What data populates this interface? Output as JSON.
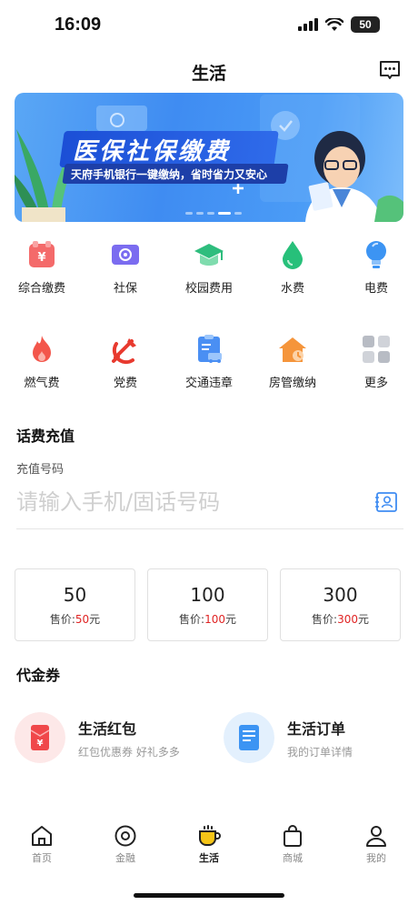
{
  "status": {
    "time": "16:09",
    "battery": "50"
  },
  "header": {
    "title": "生活",
    "message_icon": "chat-bubble-icon"
  },
  "banner": {
    "title": "医保社保缴费",
    "subtitle": "天府手机银行一键缴纳，省时省力又安心",
    "slide_count": 5,
    "active_slide": 4
  },
  "services_row1": [
    {
      "label": "综合缴费",
      "icon": "yuan-card-icon",
      "color": "#f46a6a"
    },
    {
      "label": "社保",
      "icon": "social-security-card-icon",
      "color": "#7b6cf0"
    },
    {
      "label": "校园费用",
      "icon": "graduation-cap-icon",
      "color": "#2ebd7d"
    },
    {
      "label": "水费",
      "icon": "water-drop-icon",
      "color": "#27c07a"
    },
    {
      "label": "电费",
      "icon": "light-bulb-icon",
      "color": "#3c94f3"
    }
  ],
  "services_row2": [
    {
      "label": "燃气费",
      "icon": "flame-icon",
      "color": "#f3564b"
    },
    {
      "label": "党费",
      "icon": "party-emblem-icon",
      "color": "#e83a2f"
    },
    {
      "label": "交通违章",
      "icon": "traffic-ticket-icon",
      "color": "#4a8ff3"
    },
    {
      "label": "房管缴纳",
      "icon": "house-icon",
      "color": "#f5953b"
    },
    {
      "label": "更多",
      "icon": "more-grid-icon",
      "color": "#b8bcc4"
    }
  ],
  "topup": {
    "section_title": "话费充值",
    "field_label": "充值号码",
    "placeholder": "请输入手机/固话号码",
    "amounts": [
      {
        "value": "50",
        "price_prefix": "售价:",
        "price": "50",
        "unit": "元"
      },
      {
        "value": "100",
        "price_prefix": "售价:",
        "price": "100",
        "unit": "元"
      },
      {
        "value": "300",
        "price_prefix": "售价:",
        "price": "300",
        "unit": "元"
      }
    ]
  },
  "vouchers": {
    "section_title": "代金券",
    "items": [
      {
        "title": "生活红包",
        "subtitle": "红包优惠券 好礼多多",
        "icon": "red-envelope-icon"
      },
      {
        "title": "生活订单",
        "subtitle": "我的订单详情",
        "icon": "order-list-icon"
      }
    ]
  },
  "tabbar": [
    {
      "label": "首页",
      "icon": "home-icon",
      "active": false
    },
    {
      "label": "金融",
      "icon": "finance-coin-icon",
      "active": false
    },
    {
      "label": "生活",
      "icon": "coffee-cup-icon",
      "active": true
    },
    {
      "label": "商城",
      "icon": "shopping-bag-icon",
      "active": false
    },
    {
      "label": "我的",
      "icon": "user-icon",
      "active": false
    }
  ],
  "colors": {
    "accent": "#3f8cf2",
    "price_red": "#e02424",
    "tab_active": "#f5c518"
  }
}
